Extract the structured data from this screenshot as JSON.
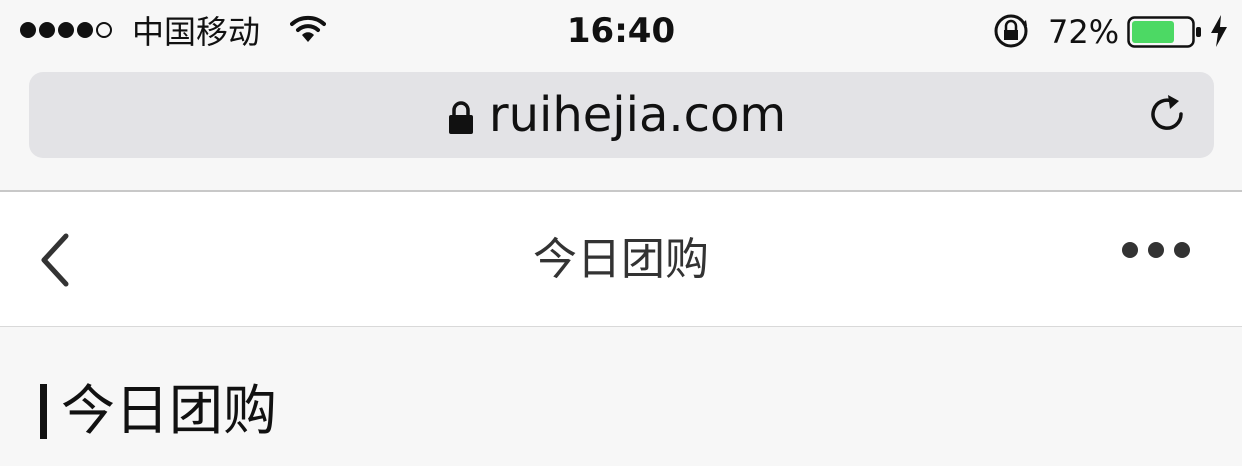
{
  "status_bar": {
    "carrier": "中国移动",
    "time": "16:40",
    "battery_percent": "72%",
    "battery_level": 0.72,
    "battery_color": "#4cd964",
    "signal_bars_filled": 4,
    "signal_bars_total": 5
  },
  "browser": {
    "url": "ruihejia.com",
    "lock_icon": "lock-icon",
    "reload_icon": "reload-icon"
  },
  "header": {
    "title": "今日团购",
    "back_icon": "chevron-left-icon",
    "more_icon": "more-dots-icon"
  },
  "section": {
    "title": "今日团购"
  }
}
